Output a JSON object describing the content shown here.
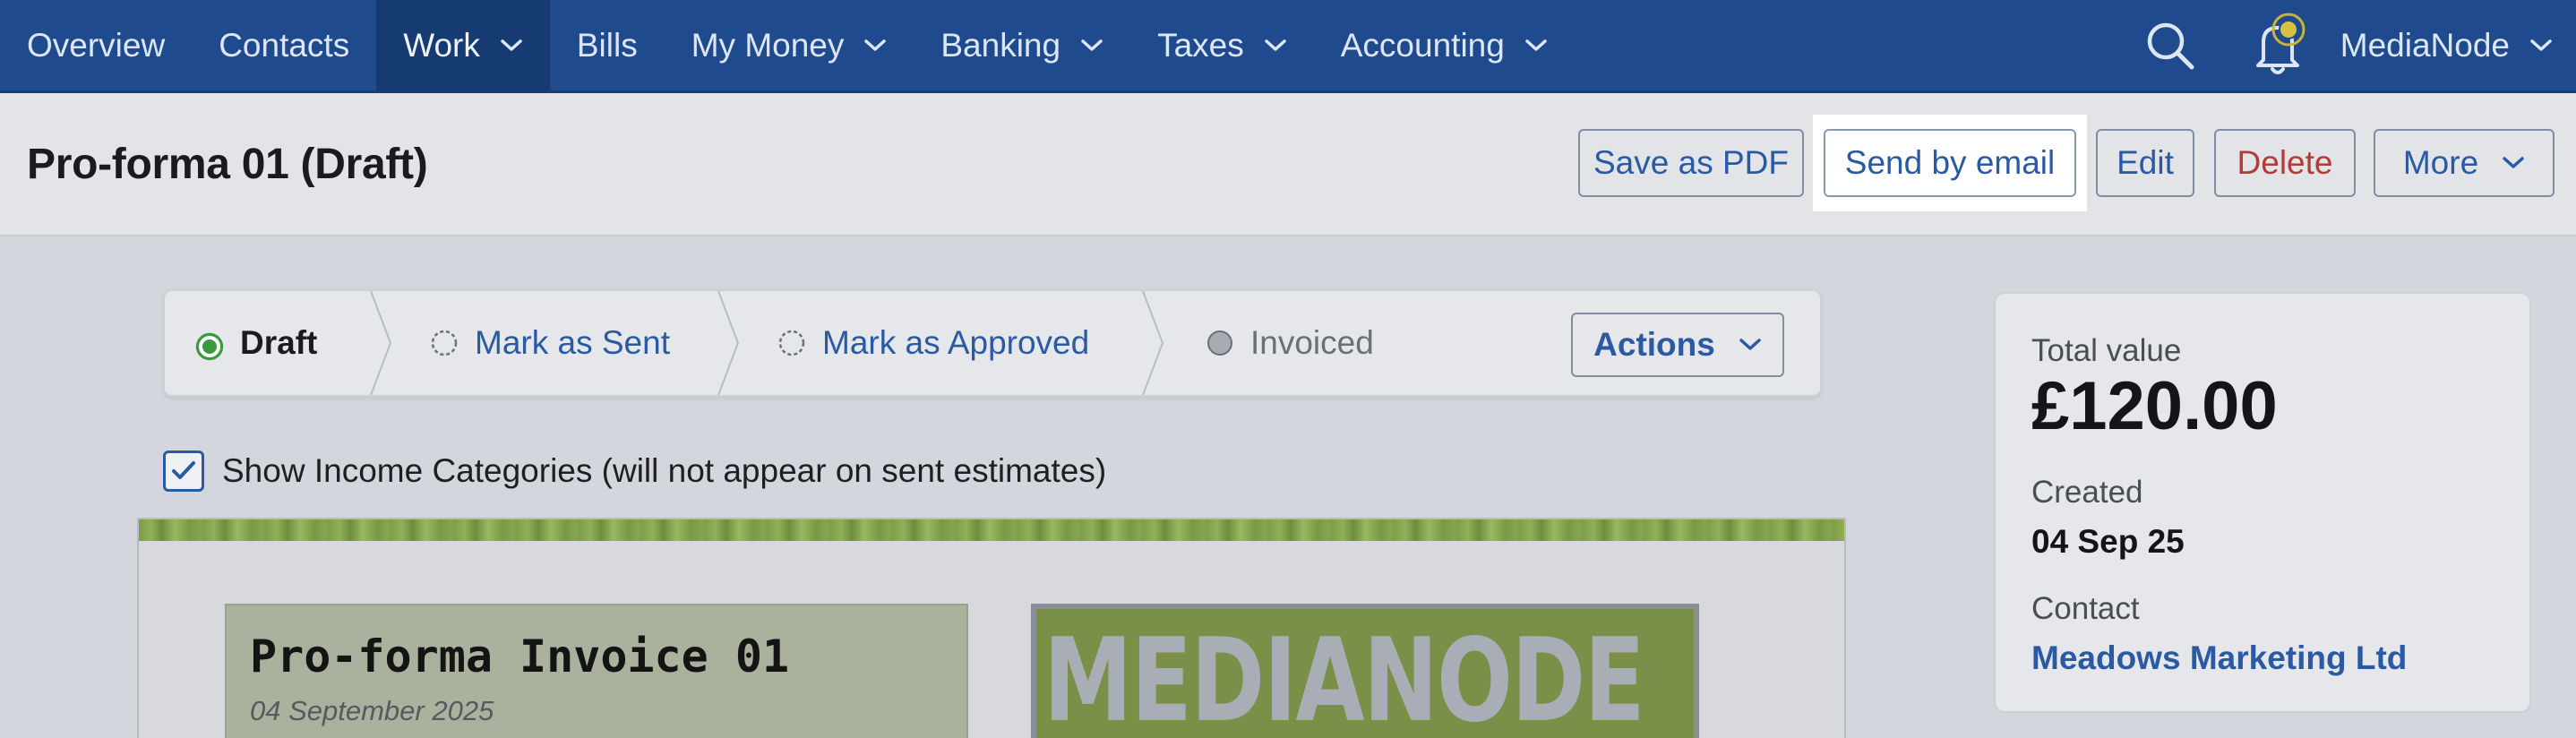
{
  "nav": {
    "items": [
      {
        "label": "Overview",
        "has_menu": false,
        "active": false
      },
      {
        "label": "Contacts",
        "has_menu": false,
        "active": false
      },
      {
        "label": "Work",
        "has_menu": true,
        "active": true
      },
      {
        "label": "Bills",
        "has_menu": false,
        "active": false
      },
      {
        "label": "My Money",
        "has_menu": true,
        "active": false
      },
      {
        "label": "Banking",
        "has_menu": true,
        "active": false
      },
      {
        "label": "Taxes",
        "has_menu": true,
        "active": false
      },
      {
        "label": "Accounting",
        "has_menu": true,
        "active": false
      }
    ],
    "user_name": "MediaNode",
    "icons": {
      "search": "search-icon",
      "notifications": "bell-icon"
    }
  },
  "header": {
    "title": "Pro-forma 01 (Draft)",
    "buttons": {
      "save_pdf": "Save as PDF",
      "send_email": "Send by email",
      "edit": "Edit",
      "delete": "Delete",
      "more": "More"
    }
  },
  "status": {
    "steps": {
      "draft": "Draft",
      "sent": "Mark as Sent",
      "approved": "Mark as Approved",
      "invoiced": "Invoiced"
    },
    "actions_label": "Actions"
  },
  "options": {
    "show_income_categories": "Show Income Categories (will not appear on sent estimates)",
    "show_income_categories_checked": true
  },
  "document": {
    "title": "Pro-forma Invoice 01",
    "date": "04 September 2025",
    "logo_text": "MEDIANODE"
  },
  "summary": {
    "total_label": "Total value",
    "total_value": "£120.00",
    "created_label": "Created",
    "created_value": "04 Sep 25",
    "contact_label": "Contact",
    "contact_value": "Meadows Marketing Ltd"
  },
  "colors": {
    "nav_bg": "#1f4b8e",
    "link": "#2a5aa4",
    "delete": "#b33a35",
    "draft_green": "#3a9a3f"
  }
}
